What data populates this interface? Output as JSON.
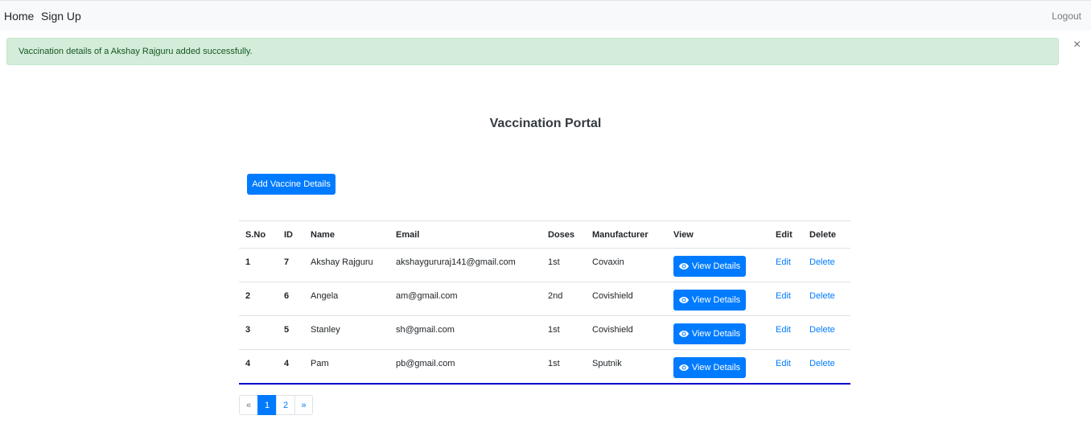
{
  "nav": {
    "home": "Home",
    "signup": "Sign Up",
    "logout": "Logout"
  },
  "alert": {
    "message": "Vaccination details of a Akshay Rajguru added successfully.",
    "close": "×"
  },
  "page": {
    "title": "Vaccination Portal",
    "add_button": "Add Vaccine Details"
  },
  "table": {
    "headers": {
      "sno": "S.No",
      "id": "ID",
      "name": "Name",
      "email": "Email",
      "doses": "Doses",
      "manufacturer": "Manufacturer",
      "view": "View",
      "edit": "Edit",
      "delete": "Delete"
    },
    "view_label": "View Details",
    "edit_label": "Edit",
    "delete_label": "Delete",
    "rows": [
      {
        "sno": "1",
        "id": "7",
        "name": "Akshay Rajguru",
        "email": "akshaygururaj141@gmail.com",
        "doses": "1st",
        "manufacturer": "Covaxin"
      },
      {
        "sno": "2",
        "id": "6",
        "name": "Angela",
        "email": "am@gmail.com",
        "doses": "2nd",
        "manufacturer": "Covishield"
      },
      {
        "sno": "3",
        "id": "5",
        "name": "Stanley",
        "email": "sh@gmail.com",
        "doses": "1st",
        "manufacturer": "Covishield"
      },
      {
        "sno": "4",
        "id": "4",
        "name": "Pam",
        "email": "pb@gmail.com",
        "doses": "1st",
        "manufacturer": "Sputnik"
      }
    ]
  },
  "pagination": {
    "prev": "«",
    "pages": [
      "1",
      "2"
    ],
    "next": "»",
    "active": "1"
  },
  "icons": {
    "view": "eye-icon"
  },
  "colors": {
    "primary": "#007bff",
    "success_bg": "#d4edda",
    "success_text": "#155724",
    "table_bottom": "#0000cc"
  }
}
